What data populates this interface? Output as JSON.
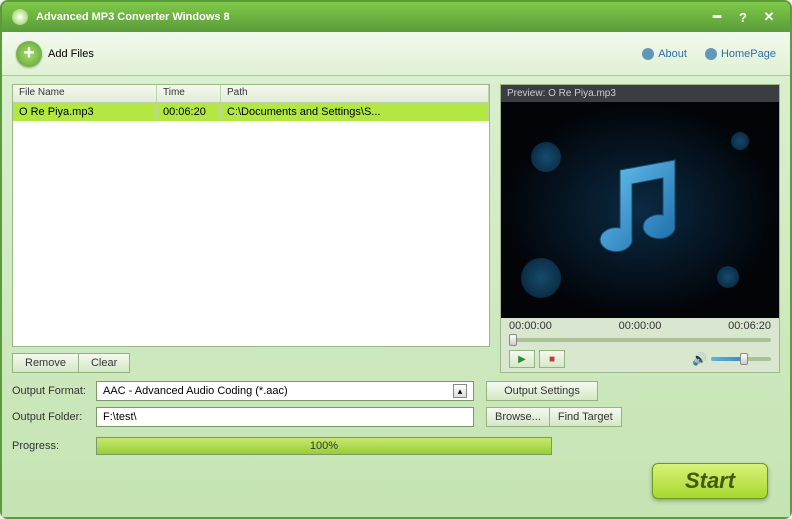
{
  "titlebar": {
    "title": "Advanced MP3 Converter Windows 8"
  },
  "toolbar": {
    "addFiles": "Add Files",
    "about": "About",
    "homePage": "HomePage"
  },
  "table": {
    "headers": {
      "fileName": "File Name",
      "time": "Time",
      "path": "Path"
    },
    "row": {
      "fileName": "O Re Piya.mp3",
      "time": "00:06:20",
      "path": "C:\\Documents and Settings\\S..."
    }
  },
  "buttons": {
    "remove": "Remove",
    "clear": "Clear",
    "browse": "Browse...",
    "findTarget": "Find Target",
    "outputSettings": "Output Settings",
    "start": "Start"
  },
  "preview": {
    "label": "Preview:  O Re Piya.mp3",
    "time1": "00:00:00",
    "time2": "00:00:00",
    "time3": "00:06:20"
  },
  "settings": {
    "outputFormatLbl": "Output Format:",
    "outputFormatVal": "AAC - Advanced Audio Coding (*.aac)",
    "outputFolderLbl": "Output Folder:",
    "outputFolderVal": "F:\\test\\",
    "progressLbl": "Progress:",
    "progressVal": "100%"
  }
}
